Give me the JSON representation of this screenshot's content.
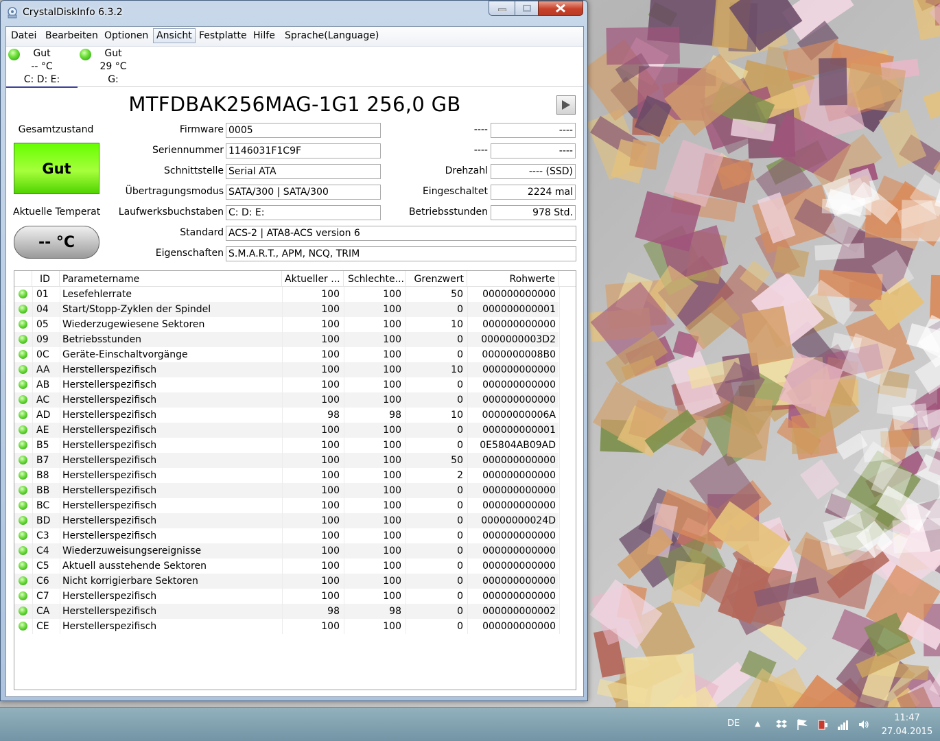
{
  "window": {
    "title": "CrystalDiskInfo 6.3.2"
  },
  "menu": [
    "Datei",
    "Bearbeiten",
    "Optionen",
    "Ansicht",
    "Festplatte",
    "Hilfe",
    "Sprache(Language)"
  ],
  "drives": [
    {
      "status": "Gut",
      "temp": "-- °C",
      "letters": "C: D: E:"
    },
    {
      "status": "Gut",
      "temp": "29 °C",
      "letters": "G:"
    }
  ],
  "model": "MTFDBAK256MAG-1G1 256,0 GB",
  "health": {
    "label": "Gesamtzustand",
    "value": "Gut"
  },
  "temperature": {
    "label": "Aktuelle Temperat",
    "value": "-- °C"
  },
  "info": {
    "firmware": {
      "label": "Firmware",
      "value": "0005"
    },
    "serial": {
      "label": "Seriennummer",
      "value": "1146031F1C9F"
    },
    "interface": {
      "label": "Schnittstelle",
      "value": "Serial ATA"
    },
    "transfer": {
      "label": "Übertragungsmodus",
      "value": "SATA/300 | SATA/300"
    },
    "letters": {
      "label": "Laufwerksbuchstaben",
      "value": "C: D: E:"
    },
    "standard": {
      "label": "Standard",
      "value": "ACS-2 | ATA8-ACS version 6"
    },
    "features": {
      "label": "Eigenschaften",
      "value": "S.M.A.R.T., APM, NCQ, TRIM"
    },
    "right1": {
      "label": "----",
      "value": "----"
    },
    "right2": {
      "label": "----",
      "value": "----"
    },
    "rpm": {
      "label": "Drehzahl",
      "value": "---- (SSD)"
    },
    "poweron_count": {
      "label": "Eingeschaltet",
      "value": "2224 mal"
    },
    "poweron_hours": {
      "label": "Betriebsstunden",
      "value": "978 Std."
    }
  },
  "table": {
    "headers": [
      "",
      "ID",
      "Parametername",
      "Aktueller ...",
      "Schlechte...",
      "Grenzwert",
      "Rohwerte"
    ],
    "rows": [
      [
        "01",
        "Lesefehlerrate",
        "100",
        "100",
        "50",
        "000000000000"
      ],
      [
        "04",
        "Start/Stopp-Zyklen der Spindel",
        "100",
        "100",
        "0",
        "000000000001"
      ],
      [
        "05",
        "Wiederzugewiesene Sektoren",
        "100",
        "100",
        "10",
        "000000000000"
      ],
      [
        "09",
        "Betriebsstunden",
        "100",
        "100",
        "0",
        "0000000003D2"
      ],
      [
        "0C",
        "Geräte-Einschaltvorgänge",
        "100",
        "100",
        "0",
        "0000000008B0"
      ],
      [
        "AA",
        "Herstellerspezifisch",
        "100",
        "100",
        "10",
        "000000000000"
      ],
      [
        "AB",
        "Herstellerspezifisch",
        "100",
        "100",
        "0",
        "000000000000"
      ],
      [
        "AC",
        "Herstellerspezifisch",
        "100",
        "100",
        "0",
        "000000000000"
      ],
      [
        "AD",
        "Herstellerspezifisch",
        "98",
        "98",
        "10",
        "00000000006A"
      ],
      [
        "AE",
        "Herstellerspezifisch",
        "100",
        "100",
        "0",
        "000000000001"
      ],
      [
        "B5",
        "Herstellerspezifisch",
        "100",
        "100",
        "0",
        "0E5804AB09AD"
      ],
      [
        "B7",
        "Herstellerspezifisch",
        "100",
        "100",
        "50",
        "000000000000"
      ],
      [
        "B8",
        "Herstellerspezifisch",
        "100",
        "100",
        "2",
        "000000000000"
      ],
      [
        "BB",
        "Herstellerspezifisch",
        "100",
        "100",
        "0",
        "000000000000"
      ],
      [
        "BC",
        "Herstellerspezifisch",
        "100",
        "100",
        "0",
        "000000000000"
      ],
      [
        "BD",
        "Herstellerspezifisch",
        "100",
        "100",
        "0",
        "00000000024D"
      ],
      [
        "C3",
        "Herstellerspezifisch",
        "100",
        "100",
        "0",
        "000000000000"
      ],
      [
        "C4",
        "Wiederzuweisungsereignisse",
        "100",
        "100",
        "0",
        "000000000000"
      ],
      [
        "C5",
        "Aktuell ausstehende Sektoren",
        "100",
        "100",
        "0",
        "000000000000"
      ],
      [
        "C6",
        "Nicht korrigierbare Sektoren",
        "100",
        "100",
        "0",
        "000000000000"
      ],
      [
        "C7",
        "Herstellerspezifisch",
        "100",
        "100",
        "0",
        "000000000000"
      ],
      [
        "CA",
        "Herstellerspezifisch",
        "98",
        "98",
        "0",
        "000000000002"
      ],
      [
        "CE",
        "Herstellerspezifisch",
        "100",
        "100",
        "0",
        "000000000000"
      ]
    ]
  },
  "taskbar": {
    "lang": "DE",
    "time": "11:47",
    "date": "27.04.2015"
  },
  "colors": {
    "good": "#66ff00",
    "led": "#4ccf1e",
    "close": "#c8412a"
  }
}
